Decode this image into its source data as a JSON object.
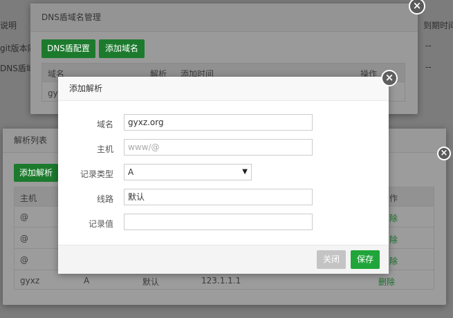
{
  "background": {
    "col_desc": "说明",
    "col_expire": "到期时间",
    "row1_desc": "git版本同",
    "row1_expire": "--",
    "row2_desc": "DNS盾域",
    "row2_expire": "--"
  },
  "dns_modal": {
    "title": "DNS盾域名管理",
    "btn_config": "DNS盾配置",
    "btn_add_domain": "添加域名",
    "headers": [
      "域名",
      "解析",
      "添加时间",
      "操作"
    ],
    "row_domain_partial": "gy"
  },
  "records_modal": {
    "title": "解析列表",
    "btn_add": "添加解析",
    "headers": [
      "主机",
      "操作"
    ],
    "header_partial_op": "作",
    "rows": [
      {
        "host": "@",
        "action": "除"
      },
      {
        "host": "@",
        "action": "除"
      },
      {
        "host": "@",
        "action": "除"
      },
      {
        "host": "gyxz",
        "type": "A",
        "line": "默认",
        "value": "123.1.1.1",
        "action": "删除"
      }
    ]
  },
  "add_modal": {
    "title": "添加解析",
    "fields": {
      "domain_label": "域名",
      "domain_value": "gyxz.org",
      "host_label": "主机",
      "host_placeholder": "www/@",
      "type_label": "记录类型",
      "type_value": "A",
      "line_label": "线路",
      "line_value": "默认",
      "value_label": "记录值",
      "value_value": ""
    },
    "btn_close": "关闭",
    "btn_save": "保存"
  },
  "icons": {
    "close": "close-icon",
    "dropdown": "chevron-down-icon"
  },
  "colors": {
    "accent": "#20a53a",
    "overlay": "#7c7c7c"
  }
}
